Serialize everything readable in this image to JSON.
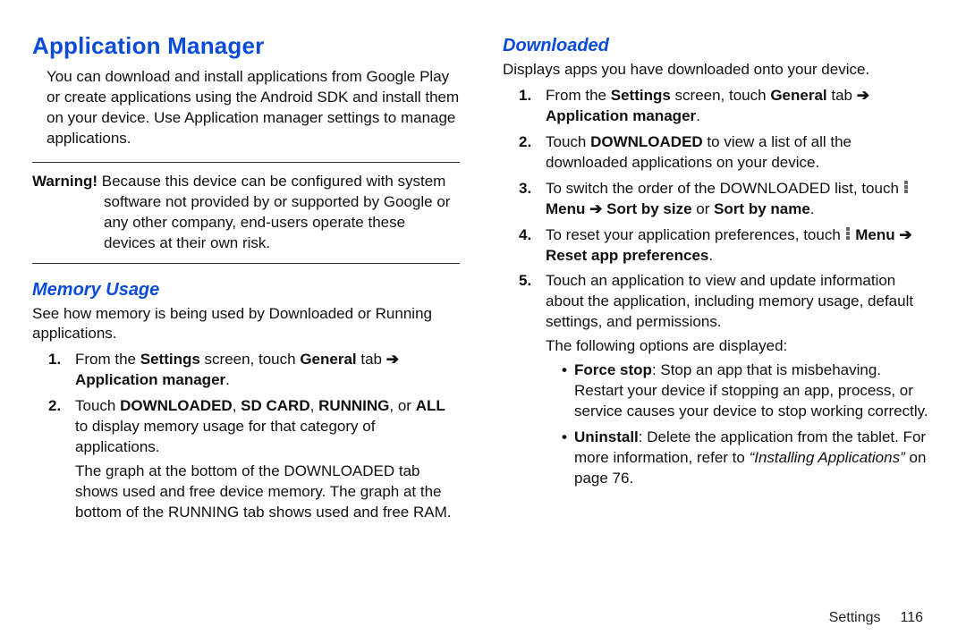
{
  "left": {
    "h1": "Application Manager",
    "intro": "You can download and install applications from Google Play or create applications using the Android SDK and install them on your device. Use Application manager settings to manage applications.",
    "warning_label": "Warning!",
    "warning_body": " Because this device can be configured with system software not provided by or supported by Google or any other company, end-users operate these devices at their own risk.",
    "h2": "Memory Usage",
    "mem_intro": "See how memory is being used by Downloaded or Running applications.",
    "mem_steps": [
      {
        "prefix": "From the ",
        "b1": "Settings",
        "mid": " screen, touch ",
        "b2": "General",
        "mid2": " tab ",
        "arrow": "➔",
        "b3": " Application manager",
        "suffix": "."
      },
      {
        "prefix": "Touch ",
        "b1": "DOWNLOADED",
        "c1": ", ",
        "b2": "SD CARD",
        "c2": ", ",
        "b3": "RUNNING",
        "c3": ", or ",
        "b4": "ALL",
        "suffix": " to display memory usage for that category of applications.",
        "note": "The graph at the bottom of the DOWNLOADED tab shows used and free device memory. The graph at the bottom of the RUNNING tab shows used and free RAM."
      }
    ]
  },
  "right": {
    "h2": "Downloaded",
    "dl_intro": "Displays apps you have downloaded onto your device.",
    "steps": [
      {
        "prefix": "From the ",
        "b1": "Settings",
        "mid": " screen, touch ",
        "b2": "General",
        "mid2": " tab ",
        "arrow": "➔",
        "b3": " Application manager",
        "suffix": "."
      },
      {
        "prefix": "Touch ",
        "b1": "DOWNLOADED",
        "suffix": " to view a list of all the downloaded applications on your device."
      },
      {
        "prefix": "To switch the order of the DOWNLOADED list, touch ",
        "menu_word": "Menu",
        "arrow": "➔",
        "b1": "Sort by size",
        "or": " or ",
        "b2": "Sort by name",
        "suffix": "."
      },
      {
        "prefix": "To reset your application preferences, touch ",
        "menu_word": "Menu",
        "arrow": "➔",
        "b1": "Reset app preferences",
        "suffix": "."
      },
      {
        "prefix": "Touch an application to view and update information about the application, including memory usage, default settings, and permissions.",
        "follow": "The following options are displayed:"
      }
    ],
    "bullets": [
      {
        "b": "Force stop",
        "t": ": Stop an app that is misbehaving. Restart your device if stopping an app, process, or service causes your device to stop working correctly."
      },
      {
        "b": "Uninstall",
        "t1": ": Delete the application from the tablet. For more information, refer to ",
        "q": "“Installing Applications”",
        "t2": " on page 76."
      }
    ]
  },
  "footer": {
    "section": "Settings",
    "page": "116"
  }
}
